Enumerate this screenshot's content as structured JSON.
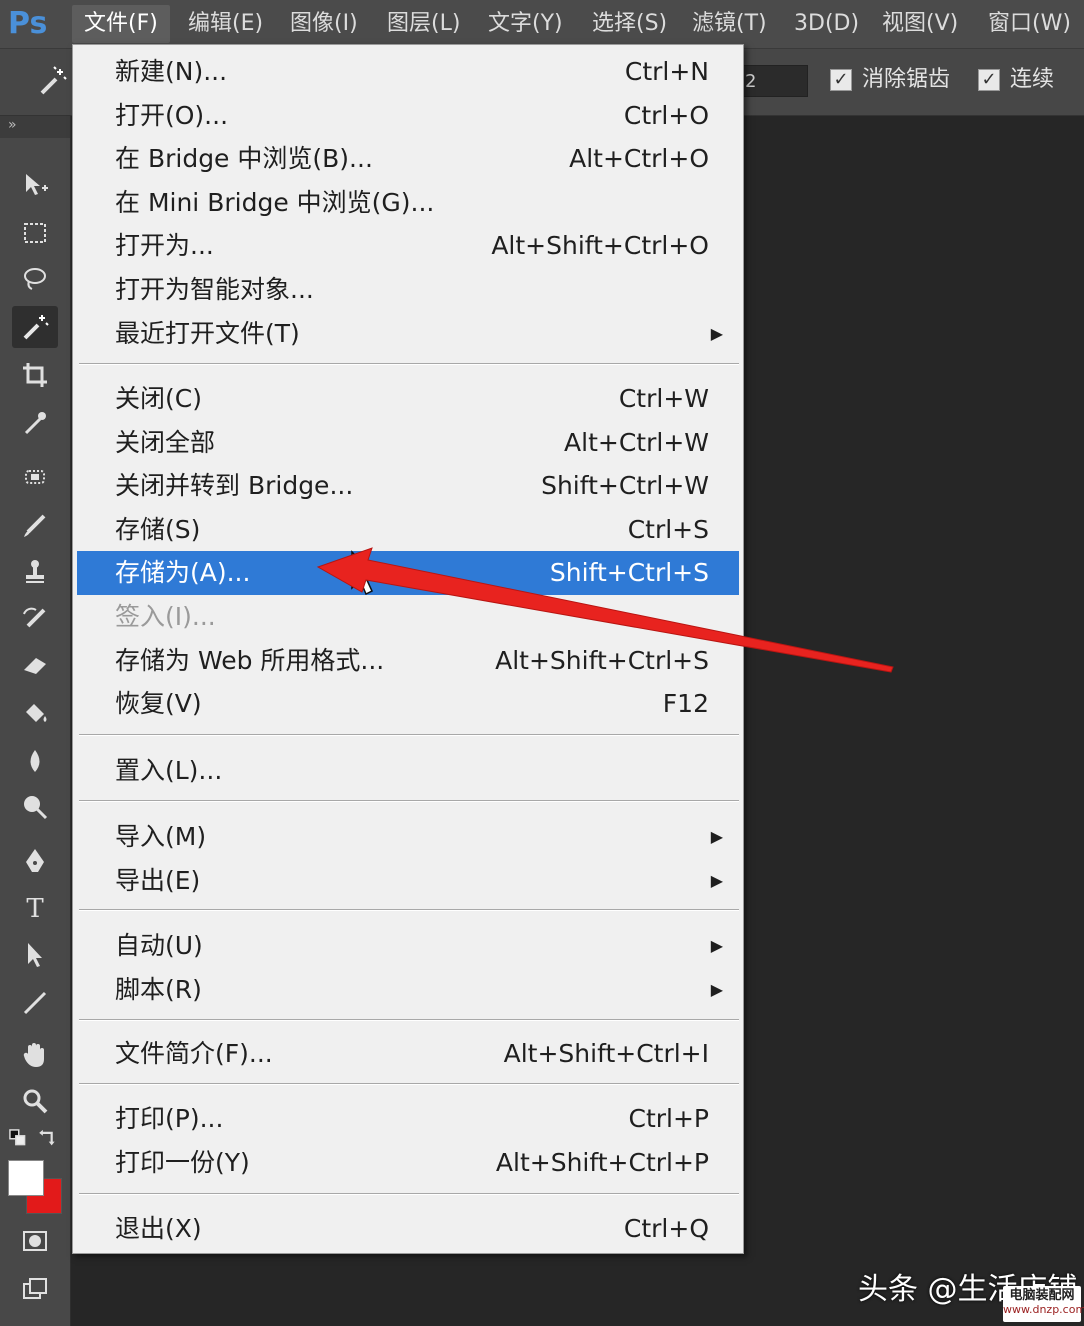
{
  "app": {
    "logo": "Ps"
  },
  "menubar": {
    "items": [
      {
        "label": "文件(F)",
        "active": true
      },
      {
        "label": "编辑(E)"
      },
      {
        "label": "图像(I)"
      },
      {
        "label": "图层(L)"
      },
      {
        "label": "文字(Y)"
      },
      {
        "label": "选择(S)"
      },
      {
        "label": "滤镜(T)"
      },
      {
        "label": "3D(D)"
      },
      {
        "label": "视图(V)"
      },
      {
        "label": "窗口(W)"
      }
    ]
  },
  "options_bar": {
    "tolerance_value": "2",
    "antialias_label": "消除锯齿",
    "antialias_checked": true,
    "contiguous_label": "连续",
    "contiguous_checked": true
  },
  "toolbar": {
    "collapse_glyph": "»",
    "tools": [
      {
        "name": "move-tool",
        "icon": "move-icon"
      },
      {
        "name": "marquee-tool",
        "icon": "marquee-icon"
      },
      {
        "name": "lasso-tool",
        "icon": "lasso-icon"
      },
      {
        "name": "magic-wand-tool",
        "icon": "magic-wand-icon",
        "selected": true
      },
      {
        "name": "crop-tool",
        "icon": "crop-icon"
      },
      {
        "name": "eyedropper-tool",
        "icon": "eyedropper-icon"
      },
      {
        "name": "healing-brush-tool",
        "icon": "bandage-icon"
      },
      {
        "name": "brush-tool",
        "icon": "brush-icon"
      },
      {
        "name": "clone-stamp-tool",
        "icon": "stamp-icon"
      },
      {
        "name": "history-brush-tool",
        "icon": "history-brush-icon"
      },
      {
        "name": "eraser-tool",
        "icon": "eraser-icon"
      },
      {
        "name": "paint-bucket-tool",
        "icon": "bucket-icon"
      },
      {
        "name": "blur-tool",
        "icon": "drop-icon"
      },
      {
        "name": "dodge-tool",
        "icon": "dodge-icon"
      },
      {
        "name": "pen-tool",
        "icon": "pen-icon"
      },
      {
        "name": "type-tool",
        "icon": "type-icon"
      },
      {
        "name": "path-selection-tool",
        "icon": "arrow-icon"
      },
      {
        "name": "line-tool",
        "icon": "line-icon"
      },
      {
        "name": "hand-tool",
        "icon": "hand-icon"
      },
      {
        "name": "zoom-tool",
        "icon": "zoom-icon"
      }
    ],
    "foreground_color": "#ffffff",
    "background_color": "#e21a1a"
  },
  "file_menu": {
    "groups": [
      [
        {
          "label": "新建(N)...",
          "shortcut": "Ctrl+N"
        },
        {
          "label": "打开(O)...",
          "shortcut": "Ctrl+O"
        },
        {
          "label": "在 Bridge 中浏览(B)...",
          "shortcut": "Alt+Ctrl+O"
        },
        {
          "label": "在 Mini Bridge 中浏览(G)...",
          "shortcut": ""
        },
        {
          "label": "打开为...",
          "shortcut": "Alt+Shift+Ctrl+O"
        },
        {
          "label": "打开为智能对象...",
          "shortcut": ""
        },
        {
          "label": "最近打开文件(T)",
          "shortcut": "",
          "submenu": true
        }
      ],
      [
        {
          "label": "关闭(C)",
          "shortcut": "Ctrl+W"
        },
        {
          "label": "关闭全部",
          "shortcut": "Alt+Ctrl+W"
        },
        {
          "label": "关闭并转到 Bridge...",
          "shortcut": "Shift+Ctrl+W"
        },
        {
          "label": "存储(S)",
          "shortcut": "Ctrl+S"
        },
        {
          "label": "存储为(A)...",
          "shortcut": "Shift+Ctrl+S",
          "highlighted": true
        },
        {
          "label": "签入(I)...",
          "shortcut": "",
          "disabled": true
        },
        {
          "label": "存储为 Web 所用格式...",
          "shortcut": "Alt+Shift+Ctrl+S"
        },
        {
          "label": "恢复(V)",
          "shortcut": "F12"
        }
      ],
      [
        {
          "label": "置入(L)...",
          "shortcut": ""
        }
      ],
      [
        {
          "label": "导入(M)",
          "shortcut": "",
          "submenu": true
        },
        {
          "label": "导出(E)",
          "shortcut": "",
          "submenu": true
        }
      ],
      [
        {
          "label": "自动(U)",
          "shortcut": "",
          "submenu": true
        },
        {
          "label": "脚本(R)",
          "shortcut": "",
          "submenu": true
        }
      ],
      [
        {
          "label": "文件简介(F)...",
          "shortcut": "Alt+Shift+Ctrl+I"
        }
      ],
      [
        {
          "label": "打印(P)...",
          "shortcut": "Ctrl+P"
        },
        {
          "label": "打印一份(Y)",
          "shortcut": "Alt+Shift+Ctrl+P"
        }
      ],
      [
        {
          "label": "退出(X)",
          "shortcut": "Ctrl+Q"
        }
      ]
    ],
    "submenu_arrow": "▶"
  },
  "annotation": {
    "arrow_color": "#e8231f"
  },
  "watermark": {
    "text": "头条 @生活店铺",
    "badge_line1": "电脑装配网",
    "badge_line2": "www.dnzp.com"
  }
}
